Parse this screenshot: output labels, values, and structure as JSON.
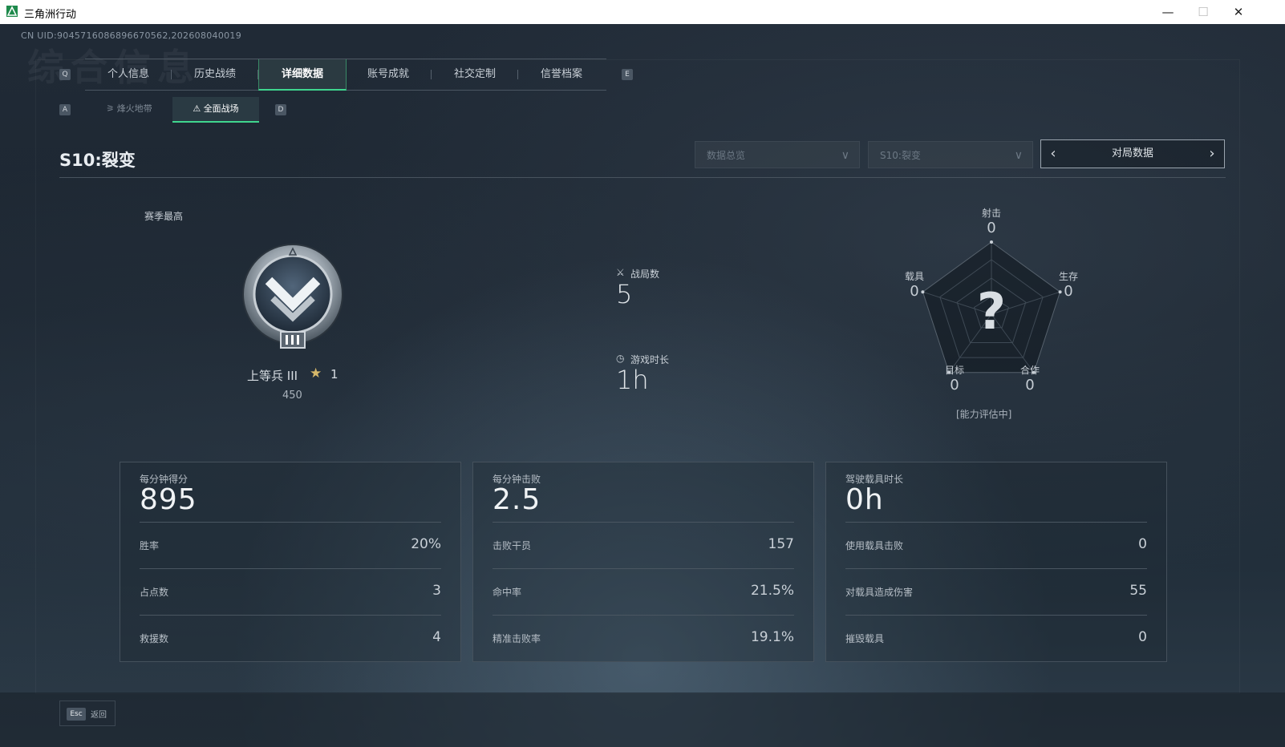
{
  "window": {
    "title": "三角洲行动"
  },
  "uid": "CN UID:9045716086896670562,202608040019",
  "watermark": "综合信息",
  "tab_keys": {
    "left": "Q",
    "right": "E"
  },
  "tabs": [
    {
      "label": "个人信息"
    },
    {
      "label": "历史战绩"
    },
    {
      "label": "详细数据",
      "active": true
    },
    {
      "label": "账号成就"
    },
    {
      "label": "社交定制"
    },
    {
      "label": "信誉档案"
    }
  ],
  "subtab_keys": {
    "left": "A",
    "right": "D"
  },
  "subtabs": [
    {
      "label": "烽火地带"
    },
    {
      "label": "全面战场",
      "active": true
    }
  ],
  "season_title": "S10:裂变",
  "dropdowns": {
    "data_type": "数据总览",
    "season": "S10:裂变"
  },
  "navigator": {
    "label": "对局数据"
  },
  "season_high_label": "赛季最高",
  "rank": {
    "name": "上等兵 III",
    "stars": "1",
    "score": "450"
  },
  "stats": {
    "matches_label": "战局数",
    "matches_value": "5",
    "playtime_label": "游戏时长",
    "playtime_value": "1h"
  },
  "radar": {
    "axes": [
      {
        "label": "射击",
        "value": "0"
      },
      {
        "label": "生存",
        "value": "0"
      },
      {
        "label": "合作",
        "value": "0"
      },
      {
        "label": "目标",
        "value": "0"
      },
      {
        "label": "载具",
        "value": "0"
      }
    ],
    "status": "[能力评估中]"
  },
  "cards": [
    {
      "head_label": "每分钟得分",
      "head_value": "895",
      "rows": [
        {
          "k": "胜率",
          "v": "20%"
        },
        {
          "k": "占点数",
          "v": "3"
        },
        {
          "k": "救援数",
          "v": "4"
        }
      ]
    },
    {
      "head_label": "每分钟击败",
      "head_value": "2.5",
      "rows": [
        {
          "k": "击败干员",
          "v": "157"
        },
        {
          "k": "命中率",
          "v": "21.5%"
        },
        {
          "k": "精准击败率",
          "v": "19.1%"
        }
      ]
    },
    {
      "head_label": "驾驶载具时长",
      "head_value": "0h",
      "rows": [
        {
          "k": "使用载具击败",
          "v": "0"
        },
        {
          "k": "对载具造成伤害",
          "v": "55"
        },
        {
          "k": "摧毁载具",
          "v": "0"
        }
      ]
    }
  ],
  "footer": {
    "esc_key": "Esc",
    "back_label": "返回"
  },
  "colors": {
    "accent": "#3fd68e",
    "background": "#1d2732",
    "text": "#d6dce2"
  }
}
